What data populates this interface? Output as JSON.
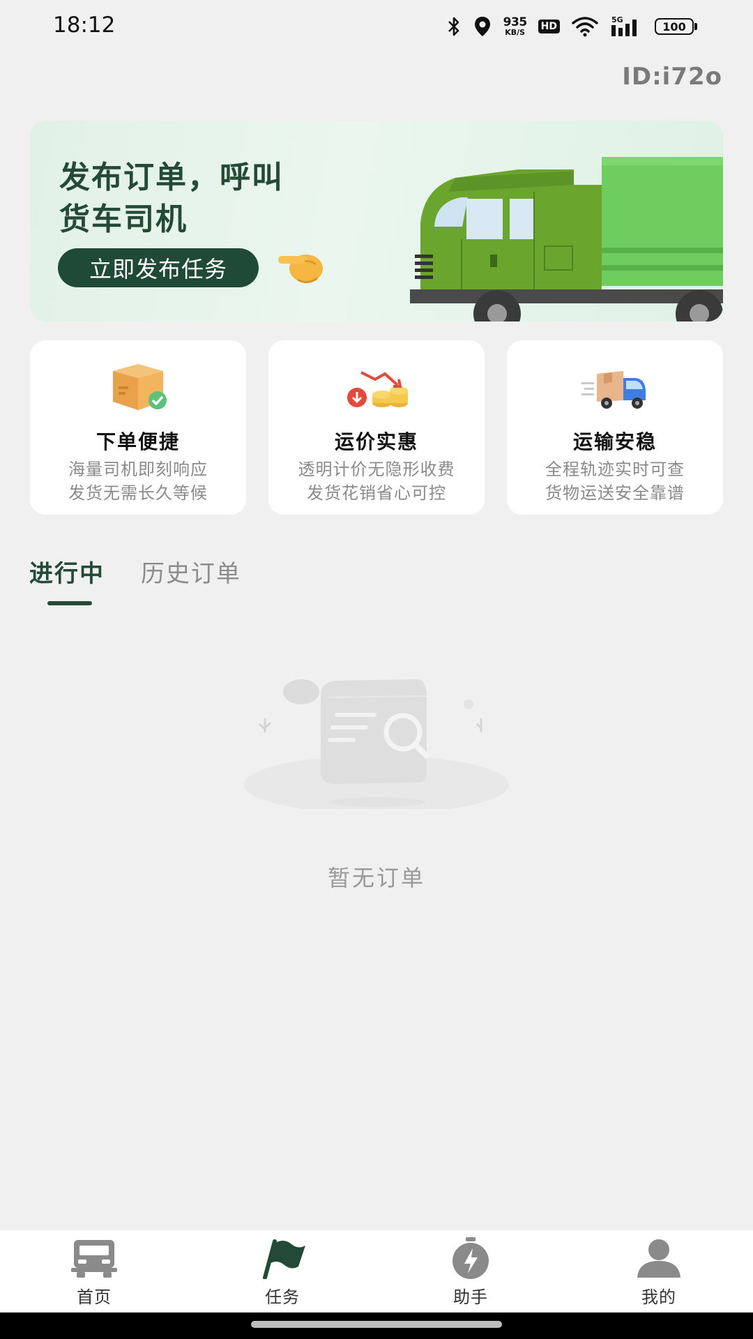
{
  "status_bar": {
    "time": "18:12",
    "net_speed": "935",
    "net_speed_unit": "KB/S",
    "hd": "HD",
    "network": "5G",
    "battery": "100",
    "icons": [
      "bluetooth-icon",
      "location-icon",
      "wifi-icon",
      "signal-icon",
      "battery-icon"
    ]
  },
  "header": {
    "user_id": "ID:i72o"
  },
  "banner": {
    "title_line1": "发布订单，呼叫",
    "title_line2": "货车司机",
    "button_label": "立即发布任务"
  },
  "features": [
    {
      "title": "下单便捷",
      "desc_line1": "海量司机即刻响应",
      "desc_line2": "发货无需长久等候",
      "icon": "package-check-icon"
    },
    {
      "title": "运价实惠",
      "desc_line1": "透明计价无隐形收费",
      "desc_line2": "发货花销省心可控",
      "icon": "coins-price-down-icon"
    },
    {
      "title": "运输安稳",
      "desc_line1": "全程轨迹实时可查",
      "desc_line2": "货物运送安全靠谱",
      "icon": "delivery-truck-icon"
    }
  ],
  "tabs": {
    "active": "进行中",
    "history": "历史订单"
  },
  "empty_state": {
    "text": "暂无订单"
  },
  "bottom_nav": [
    {
      "label": "首页",
      "icon": "truck-icon",
      "active": false
    },
    {
      "label": "任务",
      "icon": "flag-icon",
      "active": true
    },
    {
      "label": "助手",
      "icon": "lightning-icon",
      "active": false
    },
    {
      "label": "我的",
      "icon": "user-icon",
      "active": false
    }
  ],
  "colors": {
    "accent": "#234a36",
    "background": "#f0f0f0",
    "truck_green": "#6ec25a",
    "nav_inactive": "#8a8a8a"
  }
}
